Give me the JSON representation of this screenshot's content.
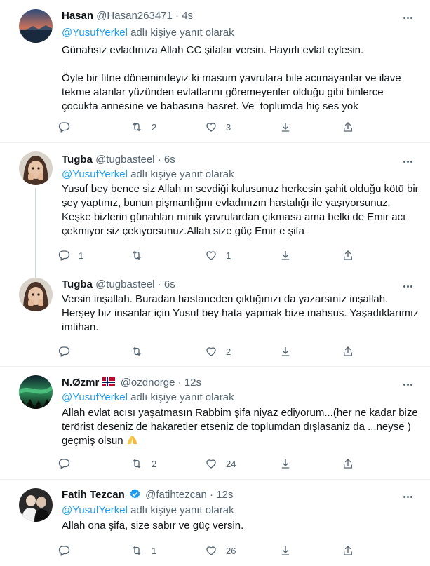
{
  "reply_prefix": "",
  "tweets": [
    {
      "name": "Hasan",
      "handle": "@Hasan263471",
      "time": "4s",
      "reply_mention": "@YusufYerkel",
      "reply_suffix": " adlı kişiye yanıt olarak",
      "text": "Günahsız evladınıza Allah CC şifalar versin. Hayırlı evlat eylesin.\n\nÖyle bir fitne dönemindeyiz ki masum yavrulara bile acımayanlar ve ilave tekme atanlar yüzünden evlatlarını göremeyenler olduğu gibi binlerce çocukta annesine ve babasına hasret. Ve  toplumda hiç ses yok",
      "replies": "",
      "retweets": "2",
      "likes": "3"
    },
    {
      "name": "Tugba",
      "handle": "@tugbasteel",
      "time": "6s",
      "reply_mention": "@YusufYerkel",
      "reply_suffix": " adlı kişiye yanıt olarak",
      "text": "Yusuf bey bence siz Allah ın sevdiği kulusunuz herkesin şahit olduğu kötü bir şey yaptınız, bunun pişmanlığını evladınızın hastalığı ile yaşıyorsunuz. Keşke bizlerin günahları minik yavrulardan çıkmasa ama belki de Emir acı çekmiyor siz çekiyorsunuz.Allah size güç Emir e şifa",
      "replies": "1",
      "retweets": "",
      "likes": "1"
    },
    {
      "name": "Tugba",
      "handle": "@tugbasteel",
      "time": "6s",
      "text": "Versin inşallah. Buradan hastaneden çıktığınızı da yazarsınız inşallah. Herşey biz insanlar için Yusuf bey hata yapmak bize mahsus. Yaşadıklarımız imtihan.",
      "replies": "",
      "retweets": "",
      "likes": "2"
    },
    {
      "name": "N.Øzmr",
      "handle": "@ozdnorge",
      "time": "12s",
      "reply_mention": "@YusufYerkel",
      "reply_suffix": " adlı kişiye yanıt olarak",
      "text": "Allah evlat acısı yaşatmasın Rabbim şifa niyaz ediyorum...(her ne kadar bize terörist deseniz de hakaretler etseniz de toplumdan dışlasaniz da ...neyse ) geçmiş olsun",
      "replies": "",
      "retweets": "2",
      "likes": "24"
    },
    {
      "name": "Fatih Tezcan",
      "handle": "@fatihtezcan",
      "time": "12s",
      "reply_mention": "@YusufYerkel",
      "reply_suffix": " adlı kişiye yanıt olarak",
      "text": "Allah ona şifa, size sabır ve güç versin.",
      "replies": "",
      "retweets": "1",
      "likes": "26"
    }
  ],
  "separator": "·",
  "icons": {
    "reply": "reply-icon",
    "retweet": "retweet-icon",
    "like": "like-icon",
    "share": "share-icon",
    "upload": "upload-icon",
    "more": "more-icon",
    "verified": "verified-icon",
    "flag": "norway-flag-icon",
    "emoji": "folded-hands-emoji"
  },
  "colors": {
    "accent": "#1d9bf0",
    "secondary_text": "#536471",
    "divider": "#eff3f4"
  }
}
